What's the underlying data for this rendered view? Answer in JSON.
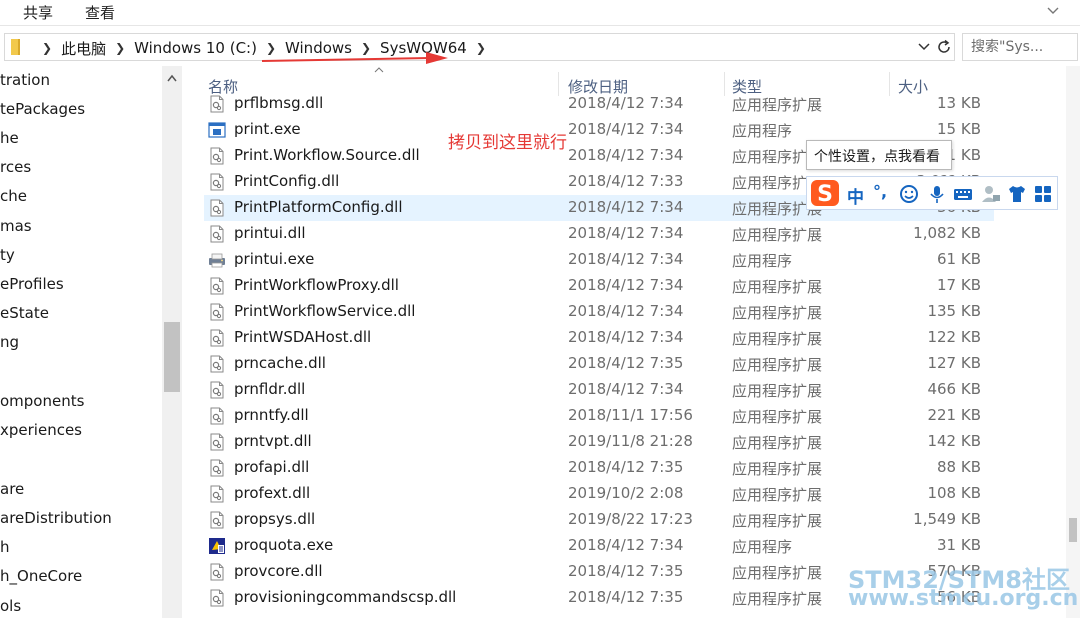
{
  "ribbon": {
    "tabs": [
      {
        "label": "共享"
      },
      {
        "label": "查看"
      }
    ]
  },
  "address": {
    "crumbs": [
      {
        "label": "此电脑"
      },
      {
        "label": "Windows 10 (C:)"
      },
      {
        "label": "Windows"
      },
      {
        "label": "SysWOW64"
      }
    ],
    "search_placeholder": "搜索\"Sys..."
  },
  "nav": {
    "items": [
      {
        "label": "tration"
      },
      {
        "label": "tePackages"
      },
      {
        "label": "he"
      },
      {
        "label": "rces"
      },
      {
        "label": "che"
      },
      {
        "label": "mas"
      },
      {
        "label": "ty"
      },
      {
        "label": "eProfiles"
      },
      {
        "label": "eState"
      },
      {
        "label": "ng"
      },
      {
        "label": ""
      },
      {
        "label": "omponents"
      },
      {
        "label": "xperiences"
      },
      {
        "label": ""
      },
      {
        "label": "are"
      },
      {
        "label": "areDistribution"
      },
      {
        "label": "h"
      },
      {
        "label": "h_OneCore"
      },
      {
        "label": "ols"
      }
    ]
  },
  "columns": {
    "name": "名称",
    "date": "修改日期",
    "type": "类型",
    "size": "大小"
  },
  "files": [
    {
      "name": "prflbmsg.dll",
      "date": "2018/4/12 7:34",
      "type": "应用程序扩展",
      "size": "13 KB",
      "icon": "dll"
    },
    {
      "name": "print.exe",
      "date": "2018/4/12 7:34",
      "type": "应用程序",
      "size": "15 KB",
      "icon": "exe-window"
    },
    {
      "name": "Print.Workflow.Source.dll",
      "date": "2018/4/12 7:34",
      "type": "应用程序扩展",
      "size": "61 KB",
      "icon": "dll"
    },
    {
      "name": "PrintConfig.dll",
      "date": "2018/4/12 7:33",
      "type": "应用程序扩展",
      "size": "3,0?? KB",
      "icon": "dll"
    },
    {
      "name": "PrintPlatformConfig.dll",
      "date": "2018/4/12 7:34",
      "type": "应用程序扩展",
      "size": "36 KB",
      "icon": "dll"
    },
    {
      "name": "printui.dll",
      "date": "2018/4/12 7:34",
      "type": "应用程序扩展",
      "size": "1,082 KB",
      "icon": "dll"
    },
    {
      "name": "printui.exe",
      "date": "2018/4/12 7:34",
      "type": "应用程序",
      "size": "61 KB",
      "icon": "printer"
    },
    {
      "name": "PrintWorkflowProxy.dll",
      "date": "2018/4/12 7:34",
      "type": "应用程序扩展",
      "size": "17 KB",
      "icon": "dll"
    },
    {
      "name": "PrintWorkflowService.dll",
      "date": "2018/4/12 7:34",
      "type": "应用程序扩展",
      "size": "135 KB",
      "icon": "dll"
    },
    {
      "name": "PrintWSDAHost.dll",
      "date": "2018/4/12 7:34",
      "type": "应用程序扩展",
      "size": "122 KB",
      "icon": "dll"
    },
    {
      "name": "prncache.dll",
      "date": "2018/4/12 7:35",
      "type": "应用程序扩展",
      "size": "127 KB",
      "icon": "dll"
    },
    {
      "name": "prnfldr.dll",
      "date": "2018/4/12 7:34",
      "type": "应用程序扩展",
      "size": "466 KB",
      "icon": "dll"
    },
    {
      "name": "prnntfy.dll",
      "date": "2018/11/1 17:56",
      "type": "应用程序扩展",
      "size": "221 KB",
      "icon": "dll"
    },
    {
      "name": "prntvpt.dll",
      "date": "2019/11/8 21:28",
      "type": "应用程序扩展",
      "size": "142 KB",
      "icon": "dll"
    },
    {
      "name": "profapi.dll",
      "date": "2018/4/12 7:35",
      "type": "应用程序扩展",
      "size": "88 KB",
      "icon": "dll"
    },
    {
      "name": "profext.dll",
      "date": "2019/10/2 2:08",
      "type": "应用程序扩展",
      "size": "108 KB",
      "icon": "dll"
    },
    {
      "name": "propsys.dll",
      "date": "2019/8/22 17:23",
      "type": "应用程序扩展",
      "size": "1,549 KB",
      "icon": "dll"
    },
    {
      "name": "proquota.exe",
      "date": "2018/4/12 7:34",
      "type": "应用程序",
      "size": "31 KB",
      "icon": "quota"
    },
    {
      "name": "provcore.dll",
      "date": "2018/4/12 7:35",
      "type": "应用程序扩展",
      "size": "570 KB",
      "icon": "dll"
    },
    {
      "name": "provisioningcommandscsp.dll",
      "date": "2018/4/12 7:35",
      "type": "应用程序扩展",
      "size": "56 KB",
      "icon": "dll"
    }
  ],
  "selected_index": 4,
  "annotation": {
    "text": "拷贝到这里就行",
    "color": "#e53935"
  },
  "ime": {
    "tooltip": "个性设置，点我看看",
    "zh_label": "中",
    "punct": "°,"
  },
  "watermark": {
    "line1": "STM32/STM8社区",
    "line2": "www.stmcu.org.cn"
  },
  "colors": {
    "accent": "#0078d7",
    "selection": "#e5f3ff",
    "header_text": "#4d6082"
  }
}
